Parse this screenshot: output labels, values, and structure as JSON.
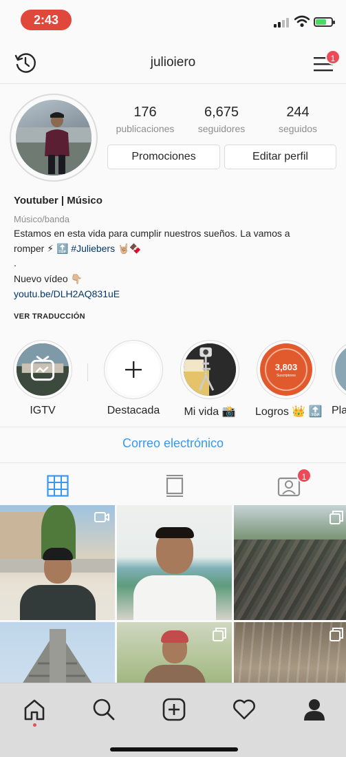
{
  "status_bar": {
    "time": "2:43"
  },
  "header": {
    "username": "julioiero",
    "menu_badge": "1"
  },
  "stats": [
    {
      "value": "176",
      "label": "publicaciones"
    },
    {
      "value": "6,675",
      "label": "seguidores"
    },
    {
      "value": "244",
      "label": "seguidos"
    }
  ],
  "buttons": {
    "promotions": "Promociones",
    "edit_profile": "Editar perfil"
  },
  "bio": {
    "name": "Youtuber | Músico",
    "category": "Músico/banda",
    "line1": "Estamos en esta vida para cumplir nuestros sueños. La vamos a",
    "line2_prefix": "romper ⚡ 🔝",
    "hashtag": "#Juliebers",
    "line2_suffix": "🤘🏼🍫",
    "line3": ".",
    "line4": "Nuevo vídeo 👇🏼",
    "link": "youtu.be/DLH2AQ831uE",
    "translate": "VER TRADUCCIÓN"
  },
  "highlights": [
    {
      "label": "IGTV"
    },
    {
      "label": "Destacada"
    },
    {
      "label": "Mi vida 📸"
    },
    {
      "label": "Logros 👑 🔝",
      "badge_number": "3,803",
      "badge_caption": "Suscriptores"
    },
    {
      "label": "Play"
    }
  ],
  "email_button": "Correo electrónico",
  "tabs": {
    "tagged_badge": "1"
  },
  "colors": {
    "accent": "#3897f0",
    "badge": "#ed4956",
    "status_pill": "#e0483b",
    "text": "#262626",
    "muted": "#8e8e8e"
  },
  "icons": [
    "history-icon",
    "menu-icon",
    "grid-icon",
    "igtv-tab-icon",
    "tagged-icon",
    "home-icon",
    "search-icon",
    "add-icon",
    "heart-icon",
    "profile-icon",
    "camera-icon",
    "multi-photo-icon"
  ]
}
